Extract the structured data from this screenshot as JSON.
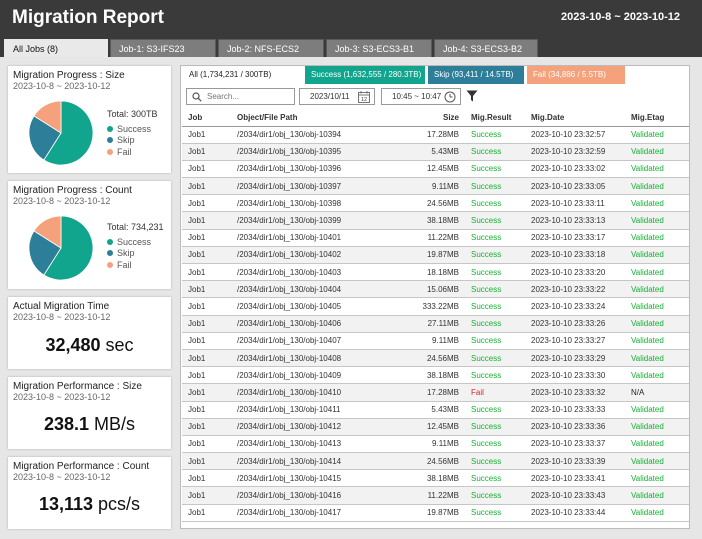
{
  "header": {
    "title": "Migration Report",
    "daterange": "2023-10-8 ~ 2023-10-12"
  },
  "tabs": [
    "All Jobs (8)",
    "Job-1: S3-IFS23",
    "Job-2: NFS-ECS2",
    "Job-3: S3-ECS3-B1",
    "Job-4: S3-ECS3-B2"
  ],
  "colors": {
    "success": "#12a58d",
    "skip": "#2d7f99",
    "fail": "#f5a27c",
    "header": "#3a3a3a"
  },
  "cards": {
    "size": {
      "title": "Migration Progress : Size",
      "sub": "2023-10-8 ~ 2023-10-12",
      "total": "Total: 300TB",
      "legend": [
        "Success",
        "Skip",
        "Fail"
      ],
      "slices": [
        {
          "name": "Success",
          "percent": 59
        },
        {
          "name": "Skip",
          "percent": 25
        },
        {
          "name": "Fail",
          "percent": 16
        }
      ]
    },
    "count": {
      "title": "Migration Progress : Count",
      "sub": "2023-10-8 ~ 2023-10-12",
      "total": "Total: 734,231",
      "legend": [
        "Success",
        "Skip",
        "Fail"
      ],
      "slices": [
        {
          "name": "Success",
          "percent": 59
        },
        {
          "name": "Skip",
          "percent": 25
        },
        {
          "name": "Fail",
          "percent": 16
        }
      ]
    },
    "time": {
      "title": "Actual Migration Time",
      "sub": "2023-10-8 ~ 2023-10-12",
      "value": "32,480",
      "unit": "sec"
    },
    "perf_size": {
      "title": "Migration Performance : Size",
      "sub": "2023-10-8 ~ 2023-10-12",
      "value": "238.1",
      "unit": "MB/s"
    },
    "perf_count": {
      "title": "Migration Performance : Count",
      "sub": "2023-10-8 ~ 2023-10-12",
      "value": "13,113",
      "unit": "pcs/s"
    }
  },
  "status_tabs": {
    "all": "All (1,734,231 / 300TB)",
    "success": "Success (1,632,555 / 280.3TB)",
    "skip": "Skip (93,411 / 14.5TB)",
    "fail": "Fail (34,886 / 5.5TB)"
  },
  "filters": {
    "search_placeholder": "Search...",
    "date": "2023/10/11",
    "calendar_day": "12",
    "time": "10:45 ~ 10:47"
  },
  "table": {
    "headers": [
      "Job",
      "Object/File Path",
      "Size",
      "Mig.Result",
      "Mig.Date",
      "Mig.Etag"
    ],
    "rows": [
      [
        "Job1",
        "/2034/dir1/obj_130/obj-10394",
        "17.28MB",
        "Success",
        "2023-10-10 23:32:57",
        "Validated"
      ],
      [
        "Job1",
        "/2034/dir1/obj_130/obj-10395",
        "5.43MB",
        "Success",
        "2023-10-10 23:32:59",
        "Validated"
      ],
      [
        "Job1",
        "/2034/dir1/obj_130/obj-10396",
        "12.45MB",
        "Success",
        "2023-10-10 23:33:02",
        "Validated"
      ],
      [
        "Job1",
        "/2034/dir1/obj_130/obj-10397",
        "9.11MB",
        "Success",
        "2023-10-10 23:33:05",
        "Validated"
      ],
      [
        "Job1",
        "/2034/dir1/obj_130/obj-10398",
        "24.56MB",
        "Success",
        "2023-10-10 23:33:11",
        "Validated"
      ],
      [
        "Job1",
        "/2034/dir1/obj_130/obj-10399",
        "38.18MB",
        "Success",
        "2023-10-10 23:33:13",
        "Validated"
      ],
      [
        "Job1",
        "/2034/dir1/obj_130/obj-10401",
        "11.22MB",
        "Success",
        "2023-10-10 23:33:17",
        "Validated"
      ],
      [
        "Job1",
        "/2034/dir1/obj_130/obj-10402",
        "19.87MB",
        "Success",
        "2023-10-10 23:33:18",
        "Validated"
      ],
      [
        "Job1",
        "/2034/dir1/obj_130/obj-10403",
        "18.18MB",
        "Success",
        "2023-10-10 23:33:20",
        "Validated"
      ],
      [
        "Job1",
        "/2034/dir1/obj_130/obj-10404",
        "15.06MB",
        "Success",
        "2023-10-10 23:33:22",
        "Validated"
      ],
      [
        "Job1",
        "/2034/dir1/obj_130/obj-10405",
        "333.22MB",
        "Success",
        "2023-10-10 23:33:24",
        "Validated"
      ],
      [
        "Job1",
        "/2034/dir1/obj_130/obj-10406",
        "27.11MB",
        "Success",
        "2023-10-10 23:33:26",
        "Validated"
      ],
      [
        "Job1",
        "/2034/dir1/obj_130/obj-10407",
        "9.11MB",
        "Success",
        "2023-10-10 23:33:27",
        "Validated"
      ],
      [
        "Job1",
        "/2034/dir1/obj_130/obj-10408",
        "24.56MB",
        "Success",
        "2023-10-10 23:33:29",
        "Validated"
      ],
      [
        "Job1",
        "/2034/dir1/obj_130/obj-10409",
        "38.18MB",
        "Success",
        "2023-10-10 23:33:30",
        "Validated"
      ],
      [
        "Job1",
        "/2034/dir1/obj_130/obj-10410",
        "17.28MB",
        "Fail",
        "2023-10-10 23:33:32",
        "N/A"
      ],
      [
        "Job1",
        "/2034/dir1/obj_130/obj-10411",
        "5.43MB",
        "Success",
        "2023-10-10 23:33:33",
        "Validated"
      ],
      [
        "Job1",
        "/2034/dir1/obj_130/obj-10412",
        "12.45MB",
        "Success",
        "2023-10-10 23:33:36",
        "Validated"
      ],
      [
        "Job1",
        "/2034/dir1/obj_130/obj-10413",
        "9.11MB",
        "Success",
        "2023-10-10 23:33:37",
        "Validated"
      ],
      [
        "Job1",
        "/2034/dir1/obj_130/obj-10414",
        "24.56MB",
        "Success",
        "2023-10-10 23:33:39",
        "Validated"
      ],
      [
        "Job1",
        "/2034/dir1/obj_130/obj-10415",
        "38.18MB",
        "Success",
        "2023-10-10 23:33:41",
        "Validated"
      ],
      [
        "Job1",
        "/2034/dir1/obj_130/obj-10416",
        "11.22MB",
        "Success",
        "2023-10-10 23:33:43",
        "Validated"
      ],
      [
        "Job1",
        "/2034/dir1/obj_130/obj-10417",
        "19.87MB",
        "Success",
        "2023-10-10 23:33:44",
        "Validated"
      ]
    ]
  }
}
